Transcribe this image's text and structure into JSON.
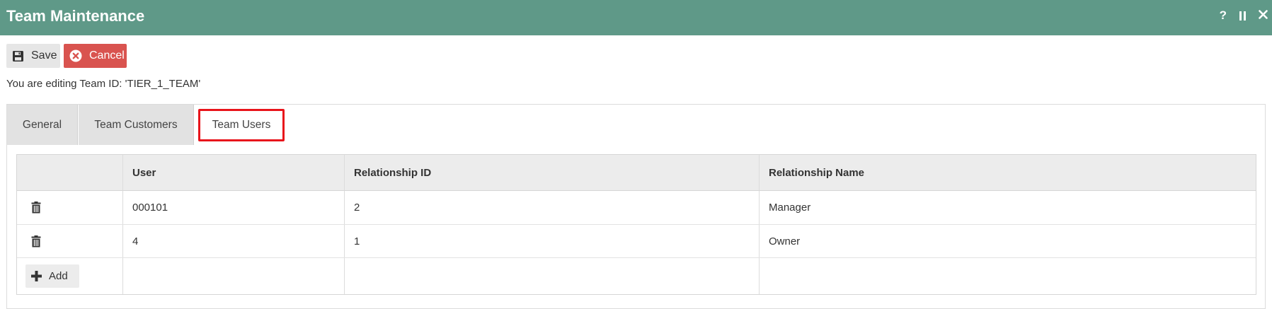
{
  "window": {
    "title": "Team Maintenance",
    "help_icon": "?",
    "colors": {
      "titlebar": "#5f9988",
      "cancel": "#d9534f",
      "highlight": "#e8141b"
    }
  },
  "toolbar": {
    "save_label": "Save",
    "cancel_label": "Cancel"
  },
  "editing_text": "You are editing Team ID: 'TIER_1_TEAM'",
  "tabs": [
    {
      "label": "General",
      "active": false
    },
    {
      "label": "Team Customers",
      "active": false
    },
    {
      "label": "Team Users",
      "active": true
    }
  ],
  "grid": {
    "columns": [
      "",
      "User",
      "Relationship ID",
      "Relationship Name"
    ],
    "rows": [
      {
        "user": "000101",
        "relationship_id": "2",
        "relationship_name": "Manager"
      },
      {
        "user": "4",
        "relationship_id": "1",
        "relationship_name": "Owner"
      }
    ],
    "add_label": "Add"
  }
}
